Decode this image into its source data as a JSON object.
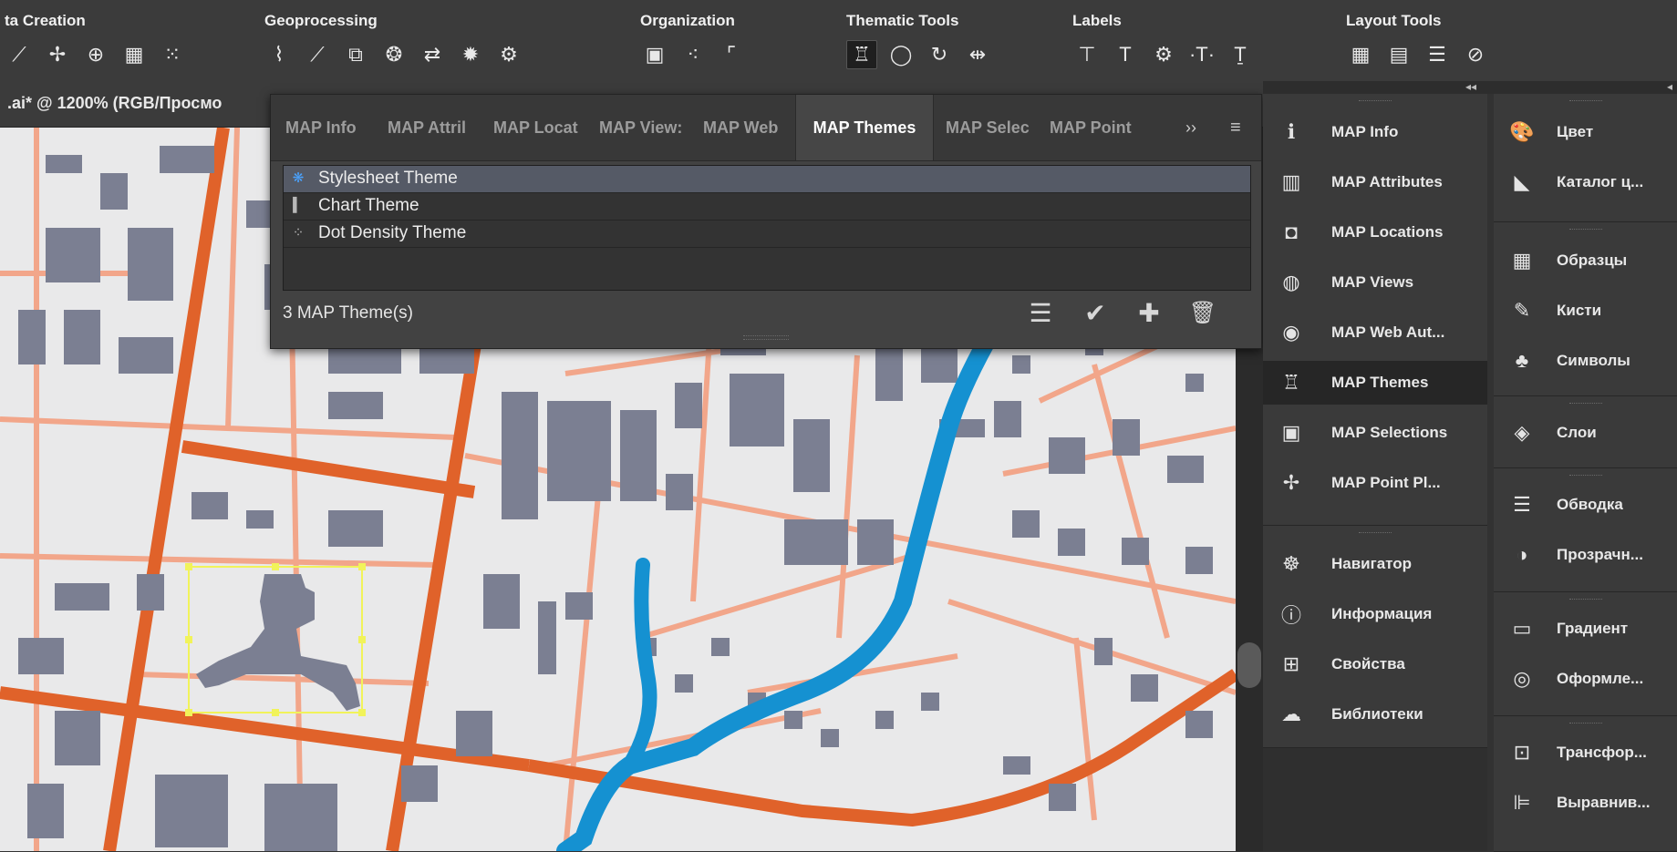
{
  "toolbar": {
    "groups": [
      {
        "label": "ta Creation",
        "icons": [
          "draw-line-icon",
          "add-points-icon",
          "add-location-icon",
          "table-icon",
          "split-points-icon"
        ]
      },
      {
        "label": "Geoprocessing",
        "icons": [
          "simplify-path-icon",
          "smooth-path-icon",
          "clip-icon",
          "dissolve-icon",
          "swap-icon",
          "process-icon",
          "gear-grid-icon"
        ]
      },
      {
        "label": "Organization",
        "icons": [
          "frame-icon",
          "scatter-icon",
          "extent-icon"
        ]
      },
      {
        "label": "Thematic Tools",
        "icons": [
          "themes-icon",
          "ellipse-icon",
          "rotate-icon",
          "fit-icon"
        ]
      },
      {
        "label": "Labels",
        "icons": [
          "add-label-icon",
          "label-text-icon",
          "label-settings-icon",
          "text-spacing-icon",
          "text-baseline-icon"
        ]
      },
      {
        "label": "Layout Tools",
        "icons": [
          "grid-icon",
          "legend-icon",
          "scale-bar-icon",
          "compass-icon"
        ]
      }
    ]
  },
  "document_tab": {
    "title": ".ai* @ 1200% (RGB/Просмо"
  },
  "themes_panel": {
    "tabs": [
      "MAP Info",
      "MAP Attril",
      "MAP Locat",
      "MAP View:",
      "MAP Web",
      "MAP Themes",
      "MAP Selec",
      "MAP Point"
    ],
    "active_tab": "MAP Themes",
    "more_label": "››",
    "menu_label": "≡",
    "themes": [
      {
        "name": "Stylesheet Theme",
        "icon": "stylesheet-theme-icon",
        "selected": true
      },
      {
        "name": "Chart Theme",
        "icon": "chart-theme-icon",
        "selected": false
      },
      {
        "name": "Dot Density Theme",
        "icon": "dot-density-theme-icon",
        "selected": false
      }
    ],
    "count_label": "3 MAP Theme(s)",
    "buttons": [
      "list-icon",
      "check-icon",
      "add-icon",
      "delete-icon"
    ]
  },
  "dock_left": {
    "group1": [
      {
        "label": "MAP Info",
        "icon": "map-info-icon"
      },
      {
        "label": "MAP Attributes",
        "icon": "map-attributes-icon"
      },
      {
        "label": "MAP Locations",
        "icon": "map-locations-icon"
      },
      {
        "label": "MAP Views",
        "icon": "globe-icon"
      },
      {
        "label": "MAP Web Aut...",
        "icon": "web-icon"
      },
      {
        "label": "MAP Themes",
        "icon": "themes-icon",
        "active": true
      },
      {
        "label": "MAP Selections",
        "icon": "map-selections-icon"
      },
      {
        "label": "MAP Point Pl...",
        "icon": "point-placement-icon"
      }
    ],
    "group2": [
      {
        "label": "Навигатор",
        "icon": "navigator-icon"
      },
      {
        "label": "Информация",
        "icon": "info-icon"
      },
      {
        "label": "Свойства",
        "icon": "properties-icon"
      },
      {
        "label": "Библиотеки",
        "icon": "libraries-icon"
      }
    ]
  },
  "dock_right": {
    "items": [
      {
        "label": "Цвет",
        "icon": "color-icon"
      },
      {
        "label": "Каталог ц...",
        "icon": "color-guide-icon"
      },
      {
        "label": "Образцы",
        "icon": "swatches-icon"
      },
      {
        "label": "Кисти",
        "icon": "brushes-icon"
      },
      {
        "label": "Символы",
        "icon": "symbols-icon"
      },
      {
        "label": "Слои",
        "icon": "layers-icon"
      },
      {
        "label": "Обводка",
        "icon": "stroke-icon"
      },
      {
        "label": "Прозрачн...",
        "icon": "transparency-icon"
      },
      {
        "label": "Градиент",
        "icon": "gradient-icon"
      },
      {
        "label": "Оформле...",
        "icon": "appearance-icon"
      },
      {
        "label": "Трансфор...",
        "icon": "transform-icon"
      },
      {
        "label": "Выравнив...",
        "icon": "align-icon"
      }
    ]
  },
  "colors": {
    "map_bg": "#e9e9ea",
    "building": "#7b7f92",
    "road_major": "#e0622a",
    "road_minor": "#f2a68a",
    "water": "#1591d1",
    "selection": "#f1f35a"
  }
}
